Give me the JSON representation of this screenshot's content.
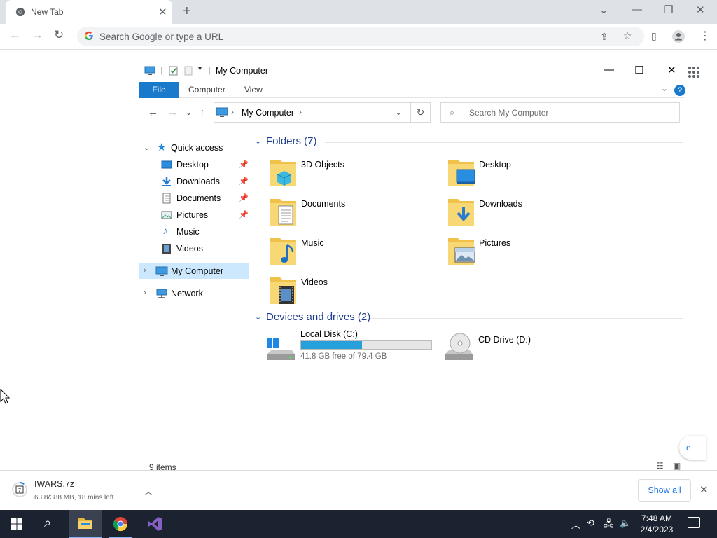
{
  "browser": {
    "tab": {
      "title": "New Tab",
      "favicon": "chrome-icon"
    },
    "omnibox": {
      "placeholder": "Search Google or type a URL"
    },
    "colors": {
      "tabstrip": "#dee1e6",
      "accent": "#1a73e8"
    }
  },
  "explorer": {
    "title": "My Computer",
    "ribbon": {
      "file": "File",
      "tabs": [
        "Computer",
        "View"
      ],
      "help": "?"
    },
    "address": {
      "crumb": "My Computer"
    },
    "search": {
      "placeholder": "Search My Computer"
    },
    "nav": {
      "quick_access": "Quick access",
      "quick_items": [
        "Desktop",
        "Downloads",
        "Documents",
        "Pictures",
        "Music",
        "Videos"
      ],
      "my_computer": "My Computer",
      "network": "Network"
    },
    "folders": {
      "header": "Folders (7)",
      "items": [
        "3D Objects",
        "Desktop",
        "Documents",
        "Downloads",
        "Music",
        "Pictures",
        "Videos"
      ]
    },
    "drives": {
      "header": "Devices and drives (2)",
      "local": {
        "name": "Local Disk (C:)",
        "free": "41.8 GB free of 79.4 GB",
        "used_fraction": 0.47
      },
      "cd": {
        "name": "CD Drive (D:)"
      }
    },
    "status": "9 items",
    "colors": {
      "file_tab": "#1979ca",
      "selection": "#cce8ff",
      "drive_bar": "#26a0da"
    }
  },
  "partial_button_text": "e",
  "download": {
    "filename": "IWARS.7z",
    "status": "63.8/388 MB, 18 mins left",
    "show_all": "Show all"
  },
  "taskbar": {
    "time": "7:48 AM",
    "date": "2/4/2023"
  }
}
